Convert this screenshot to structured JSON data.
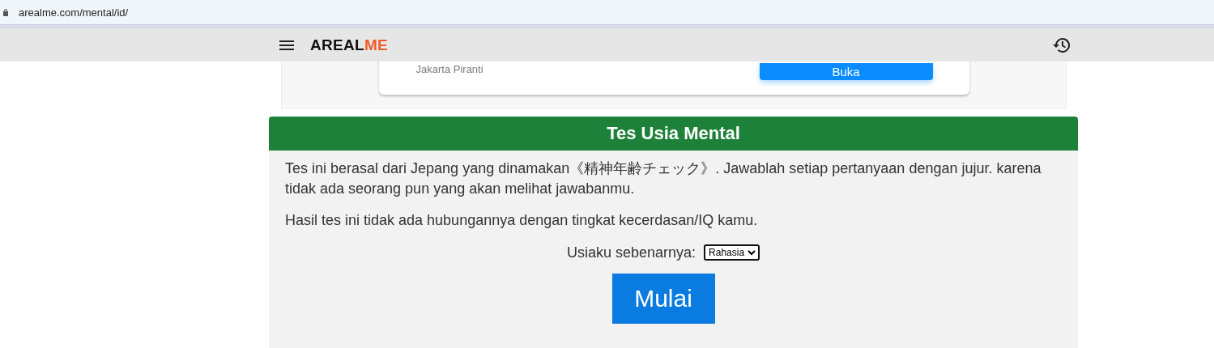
{
  "browser": {
    "url": "arealme.com/mental/id/"
  },
  "header": {
    "logo_main": "AREAL",
    "logo_accent": "ME"
  },
  "ad": {
    "advertiser": "Jakarta Piranti",
    "button": "Buka"
  },
  "panel": {
    "title": "Tes Usia Mental",
    "paragraphs": [
      "Tes ini berasal dari Jepang yang dinamakan《精神年齢チェック》. Jawablah setiap pertanyaan dengan jujur. karena tidak ada seorang pun yang akan melihat jawabanmu.",
      "Hasil tes ini tidak ada hubungannya dengan tingkat kecerdasan/IQ kamu."
    ],
    "age_label": "Usiaku sebenarnya:",
    "age_value": "Rahasia",
    "start_button": "Mulai"
  }
}
